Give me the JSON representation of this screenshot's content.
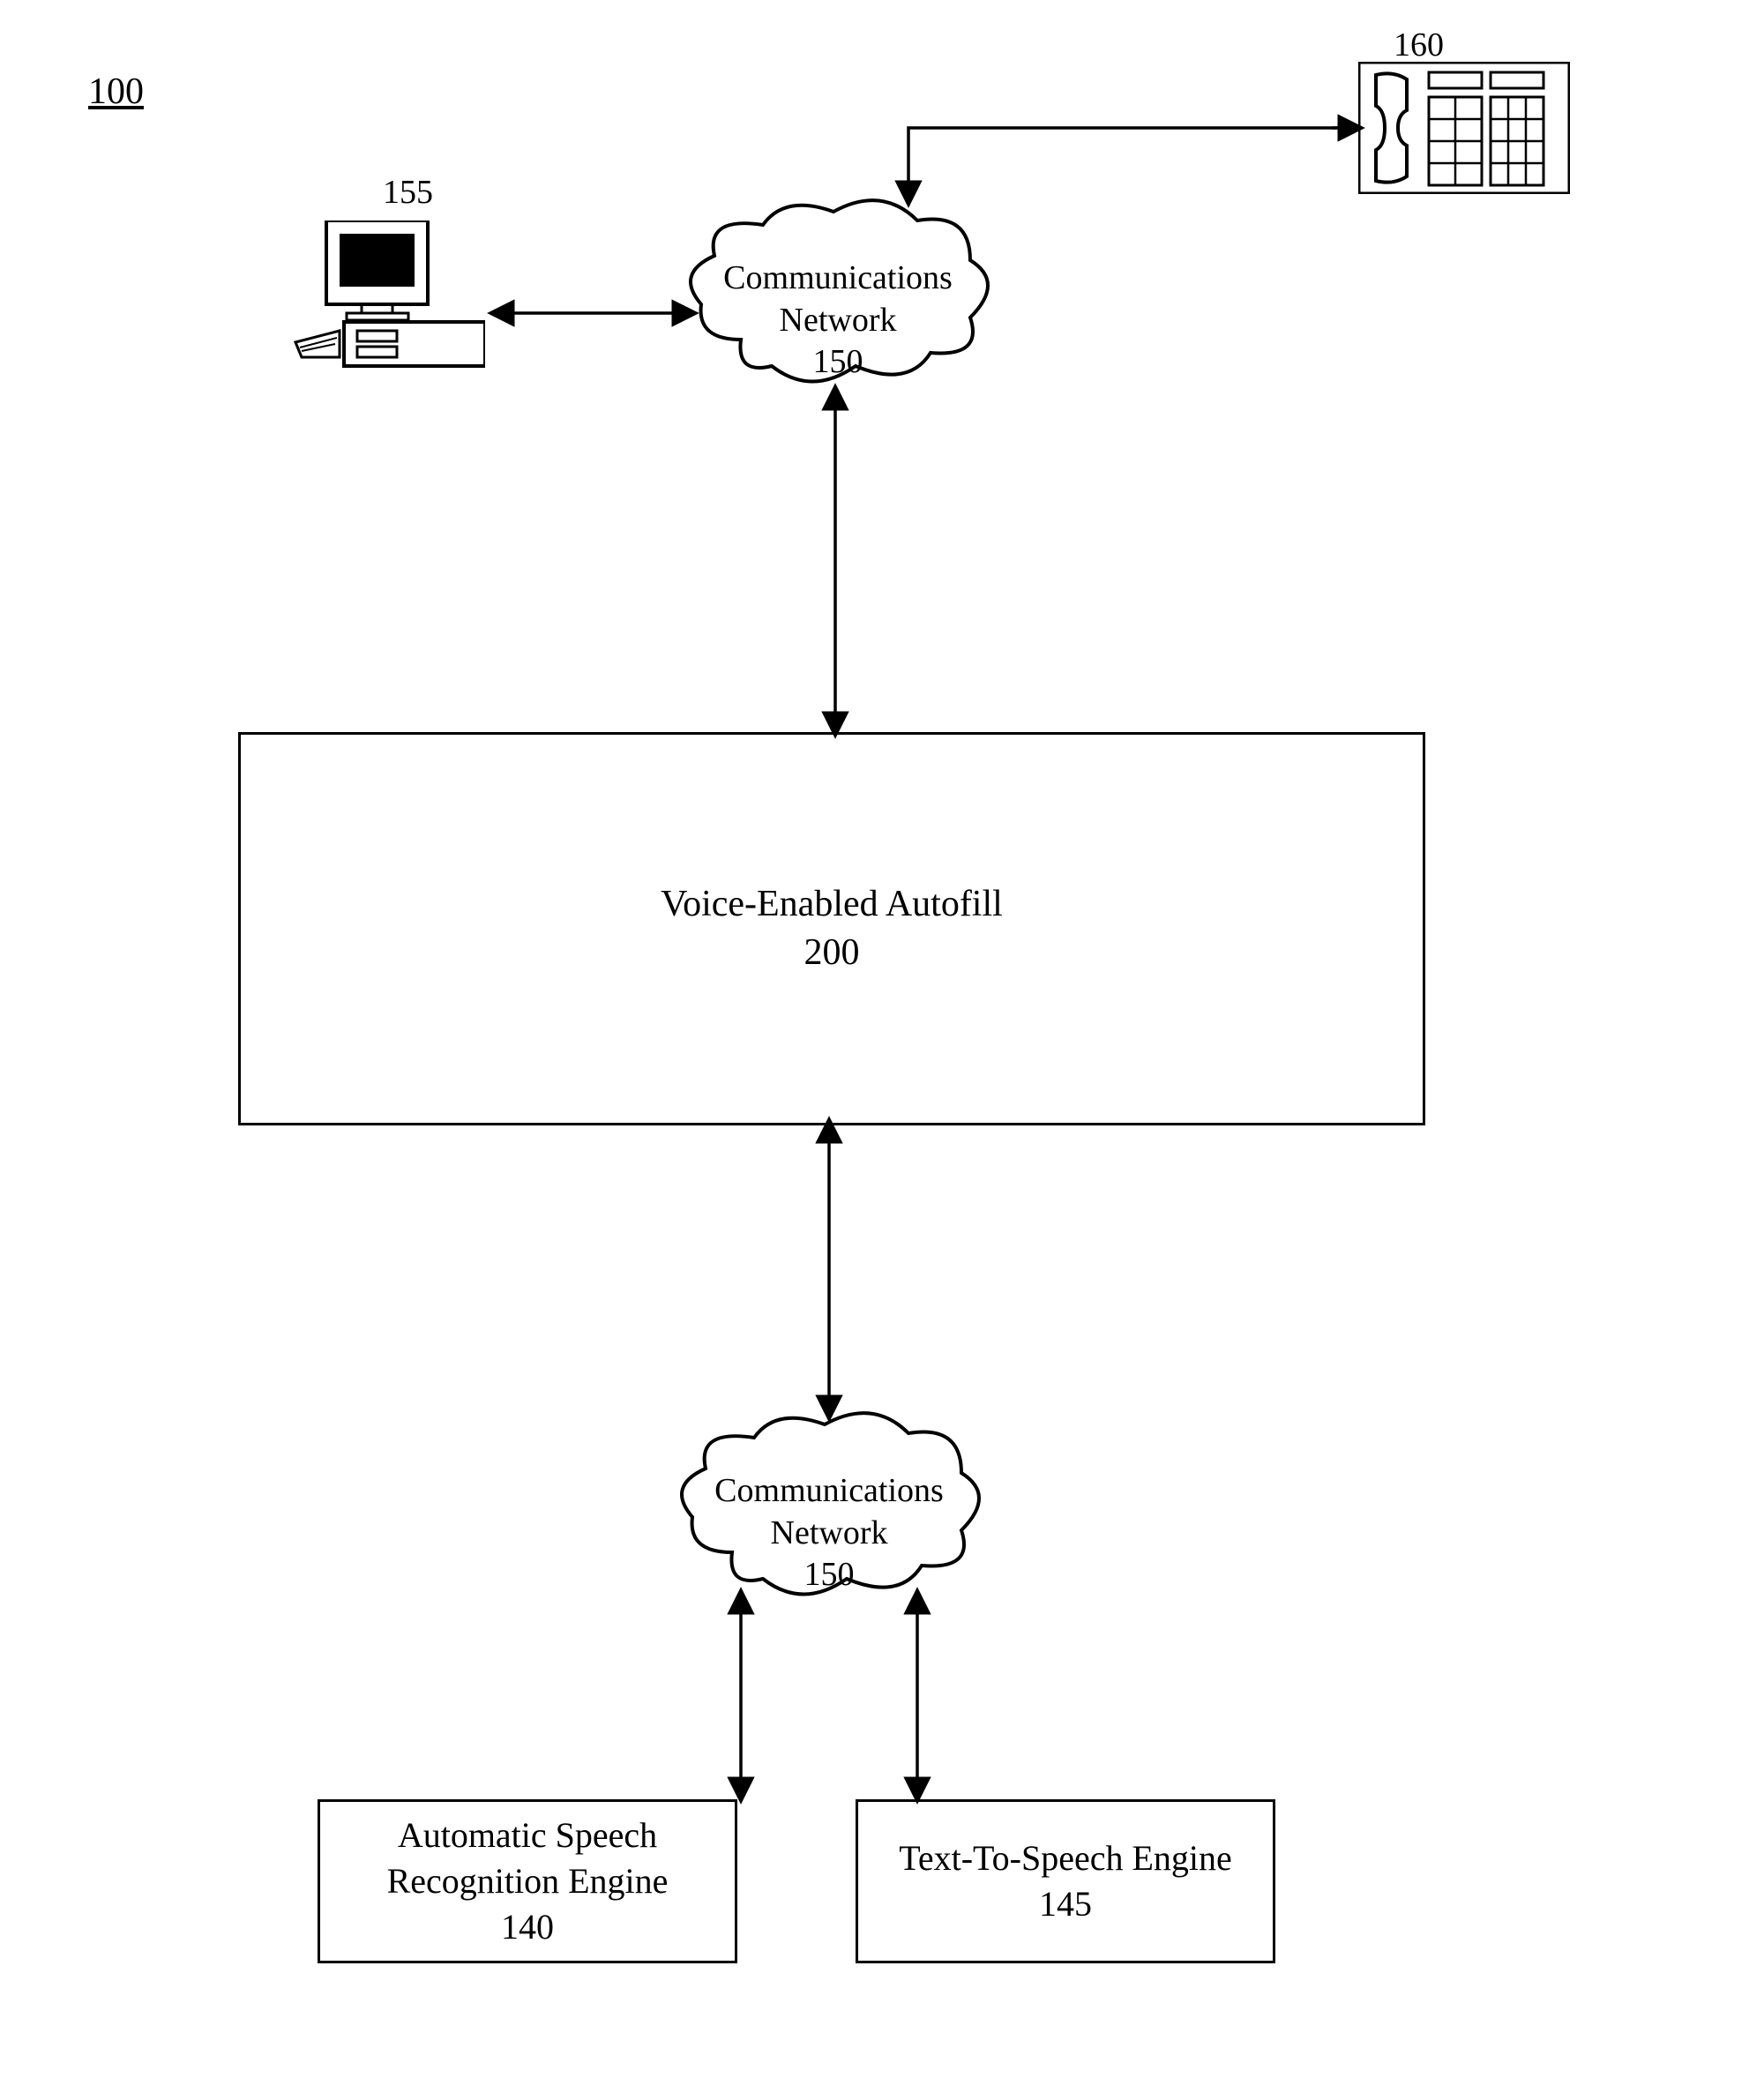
{
  "figure_number": "100",
  "labels": {
    "computer_ref": "155",
    "phone_ref": "160"
  },
  "clouds": {
    "top": {
      "line1": "Communications",
      "line2": "Network",
      "ref": "150"
    },
    "bottom": {
      "line1": "Communications",
      "line2": "Network",
      "ref": "150"
    }
  },
  "boxes": {
    "autofill": {
      "title": "Voice-Enabled Autofill",
      "ref": "200"
    },
    "asr": {
      "line1": "Automatic Speech",
      "line2": "Recognition Engine",
      "ref": "140"
    },
    "tts": {
      "line1": "Text-To-Speech Engine",
      "ref": "145"
    }
  }
}
